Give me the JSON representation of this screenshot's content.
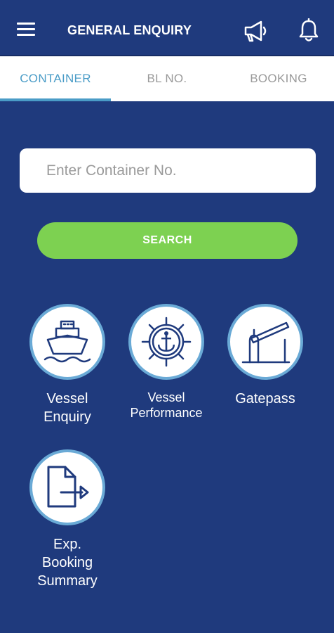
{
  "header": {
    "title": "GENERAL ENQUIRY",
    "icons": [
      "menu-icon",
      "megaphone-icon",
      "bell-icon"
    ]
  },
  "tabs": [
    {
      "label": "CONTAINER",
      "active": true
    },
    {
      "label": "BL NO.",
      "active": false
    },
    {
      "label": "BOOKING",
      "active": false
    }
  ],
  "search": {
    "placeholder": "Enter Container No.",
    "value": "",
    "button_label": "SEARCH"
  },
  "tiles": [
    {
      "line1": "Vessel",
      "line2": "Enquiry",
      "icon": "ship-icon"
    },
    {
      "line1": "Vessel",
      "line2": "Performance",
      "icon": "ship-wheel-anchor-icon"
    },
    {
      "line1": "Gatepass",
      "icon": "barrier-gate-icon"
    },
    {
      "line1": "Exp.",
      "line2": "Booking",
      "line3": "Summary",
      "icon": "document-export-icon"
    }
  ],
  "colors": {
    "background": "#1f3a7d",
    "accent": "#4a9cc7",
    "button": "#7dd151",
    "icon_stroke": "#1f3a7d",
    "circle_border": "#6aaad6"
  }
}
